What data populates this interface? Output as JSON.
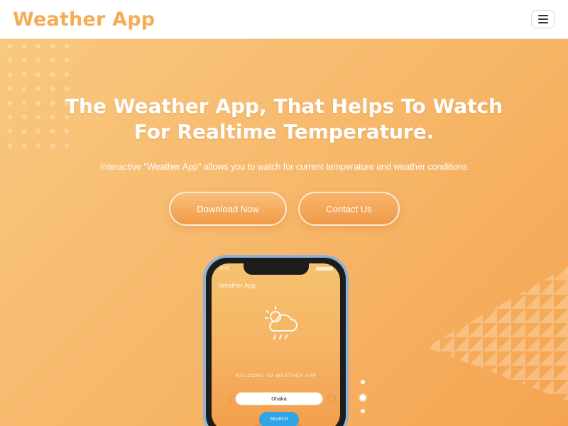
{
  "header": {
    "brand": "Weather App",
    "menu_icon": "hamburger-menu-icon"
  },
  "hero": {
    "title_line1": "The Weather App, That Helps To Watch",
    "title_line2": "For Realtime Temperature.",
    "subtitle": "Interactive \"Weather App\" allows you to watch for current temperature and weather conditions",
    "download_label": "Download Now",
    "contact_label": "Contact Us"
  },
  "phone": {
    "status_time": "9:41",
    "app_title": "Weather App",
    "weather_icon": "cloud-rain-sun-icon",
    "welcome": "WELCOME TO WEATHER APP",
    "city_value": "Dhaka",
    "search_label": "SEARCH"
  },
  "carousel": {
    "count": 3,
    "active_index": 1
  },
  "colors": {
    "brand": "#f4ad55",
    "hero_start": "#f8c87f",
    "hero_end": "#f4a450",
    "search_button": "#2fa4e7"
  }
}
